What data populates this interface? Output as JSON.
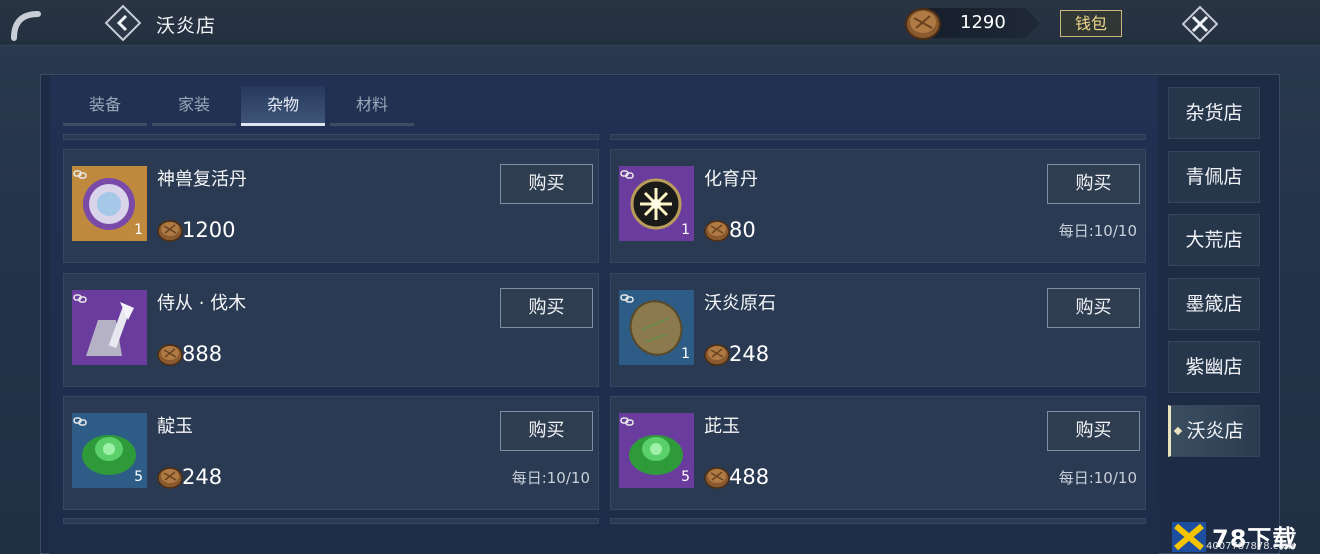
{
  "header": {
    "title": "沃炎店",
    "currency_amount": "1290",
    "wallet_label": "钱包"
  },
  "tabs": [
    {
      "label": "装备",
      "active": false
    },
    {
      "label": "家装",
      "active": false
    },
    {
      "label": "杂物",
      "active": true
    },
    {
      "label": "材料",
      "active": false
    }
  ],
  "items": [
    {
      "name": "神兽复活丹",
      "price": "1200",
      "qty": "1",
      "buy_label": "购买",
      "daily": "",
      "icon": "beast-revive-pill-icon",
      "bg": "#c08a3e"
    },
    {
      "name": "化育丹",
      "price": "80",
      "qty": "1",
      "buy_label": "购买",
      "daily": "每日:10/10",
      "icon": "nurture-pill-icon",
      "bg": "#6a3c9e"
    },
    {
      "name": "侍从 · 伐木",
      "price": "888",
      "qty": "",
      "buy_label": "购买",
      "daily": "",
      "icon": "servant-logging-icon",
      "bg": "#6a3c9e"
    },
    {
      "name": "沃炎原石",
      "price": "248",
      "qty": "1",
      "buy_label": "购买",
      "daily": "",
      "icon": "ore-stone-icon",
      "bg": "#2d5c86"
    },
    {
      "name": "靛玉",
      "price": "248",
      "qty": "5",
      "buy_label": "购买",
      "daily": "每日:10/10",
      "icon": "green-jade-icon",
      "bg": "#2d5c86"
    },
    {
      "name": "茈玉",
      "price": "488",
      "qty": "5",
      "buy_label": "购买",
      "daily": "每日:10/10",
      "icon": "purple-jade-icon",
      "bg": "#6a3c9e"
    }
  ],
  "side_tabs": [
    {
      "label": "杂货店",
      "active": false
    },
    {
      "label": "青佩店",
      "active": false
    },
    {
      "label": "大荒店",
      "active": false
    },
    {
      "label": "墨箴店",
      "active": false
    },
    {
      "label": "紫幽店",
      "active": false
    },
    {
      "label": "沃炎店",
      "active": true
    }
  ],
  "watermark": {
    "text": "78下载",
    "url": "4007787878.com"
  }
}
